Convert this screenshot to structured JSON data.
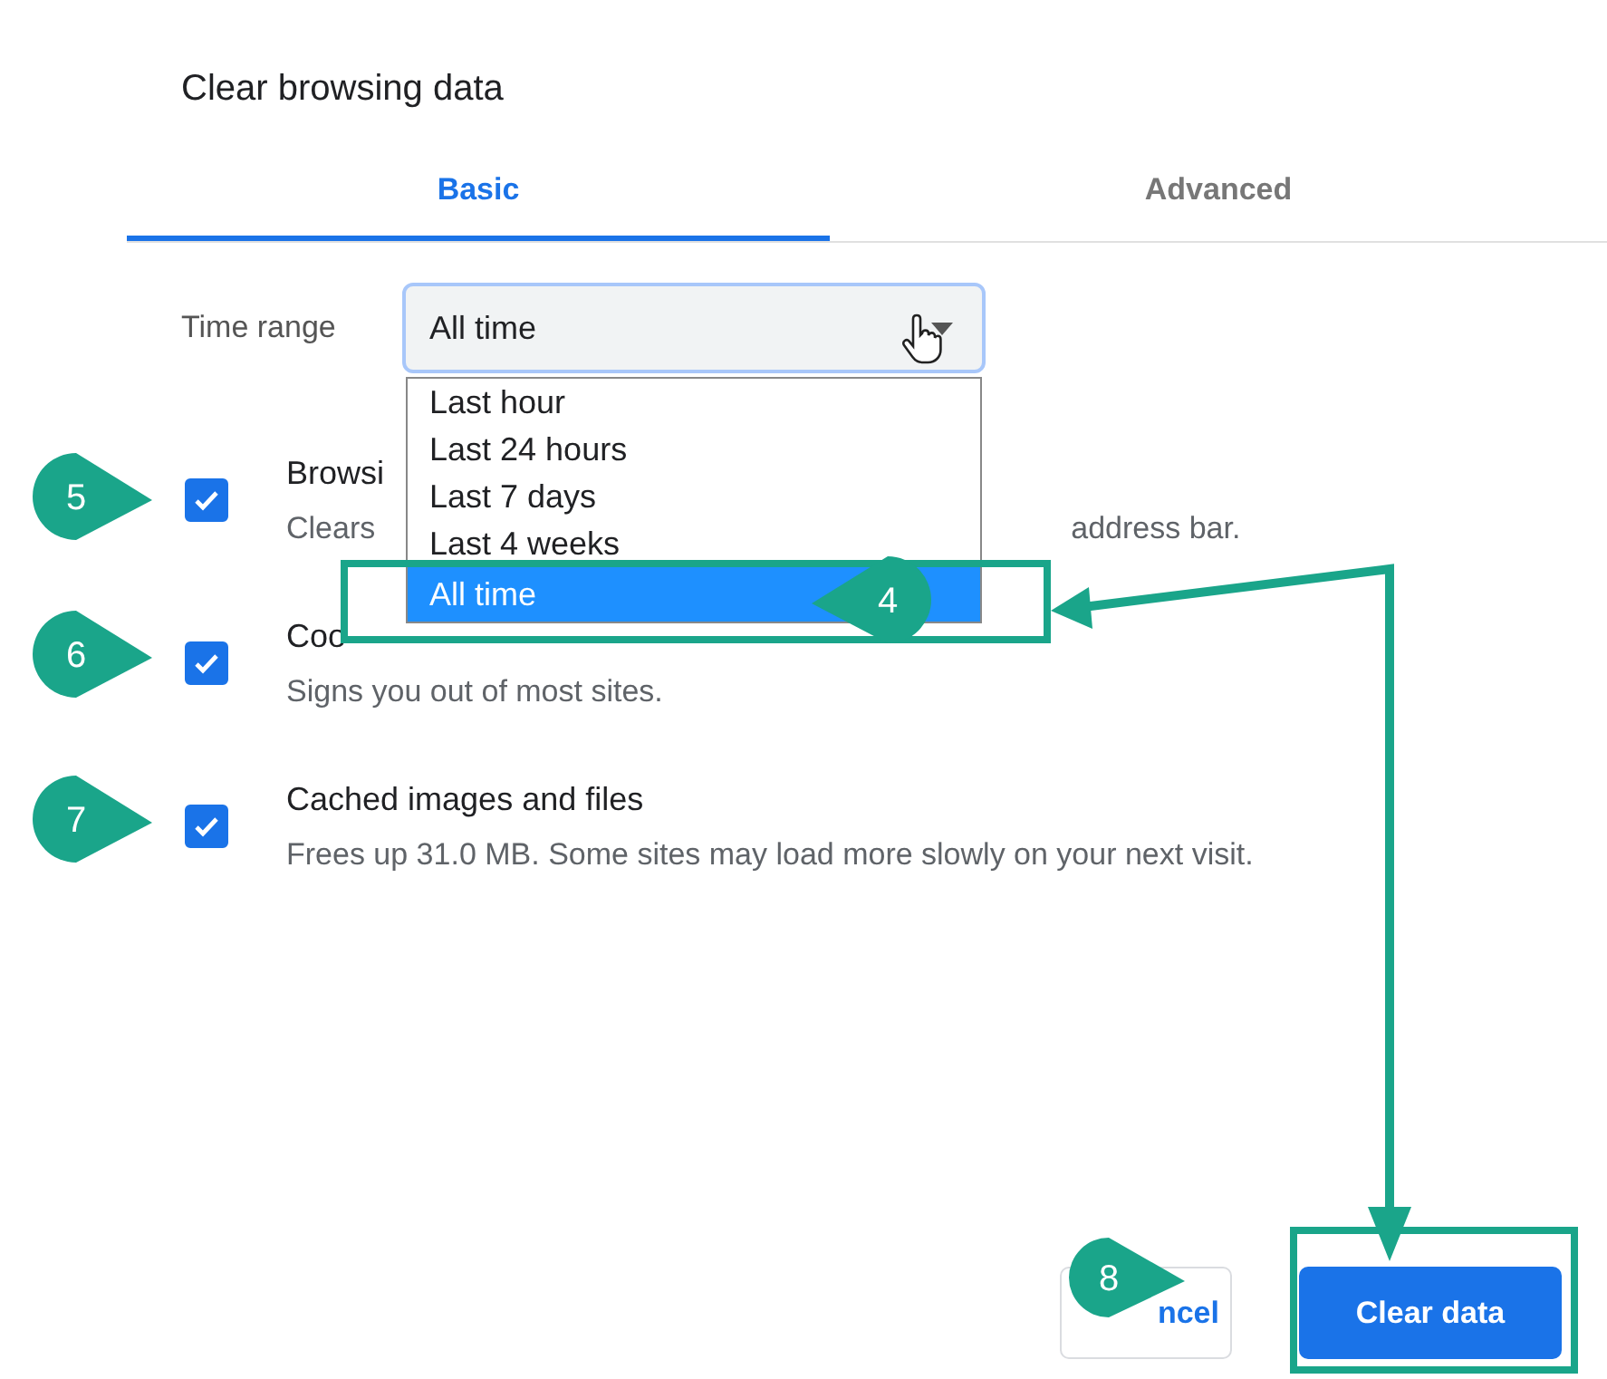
{
  "dialog": {
    "title": "Clear browsing data"
  },
  "tabs": [
    {
      "label": "Basic",
      "selected": true
    },
    {
      "label": "Advanced",
      "selected": false
    }
  ],
  "time_range": {
    "label": "Time range",
    "value": "All time",
    "options": [
      {
        "label": "Last hour",
        "selected": false
      },
      {
        "label": "Last 24 hours",
        "selected": false
      },
      {
        "label": "Last 7 days",
        "selected": false
      },
      {
        "label": "Last 4 weeks",
        "selected": false
      },
      {
        "label": "All time",
        "selected": true
      }
    ]
  },
  "items": [
    {
      "title": "Browsi",
      "description": "Clears",
      "description_end": "address bar.",
      "checked": true
    },
    {
      "title": "Coo",
      "description": "Signs you out of most sites.",
      "checked": true
    },
    {
      "title": "Cached images and files",
      "description": "Frees up 31.0 MB. Some sites may load more slowly on your next visit.",
      "checked": true
    }
  ],
  "buttons": [
    {
      "label": "ncel",
      "kind": "secondary"
    },
    {
      "label": "Clear data",
      "kind": "primary"
    }
  ],
  "callouts": [
    {
      "number": "5"
    },
    {
      "number": "6"
    },
    {
      "number": "7"
    },
    {
      "number": "4"
    },
    {
      "number": "8"
    }
  ]
}
